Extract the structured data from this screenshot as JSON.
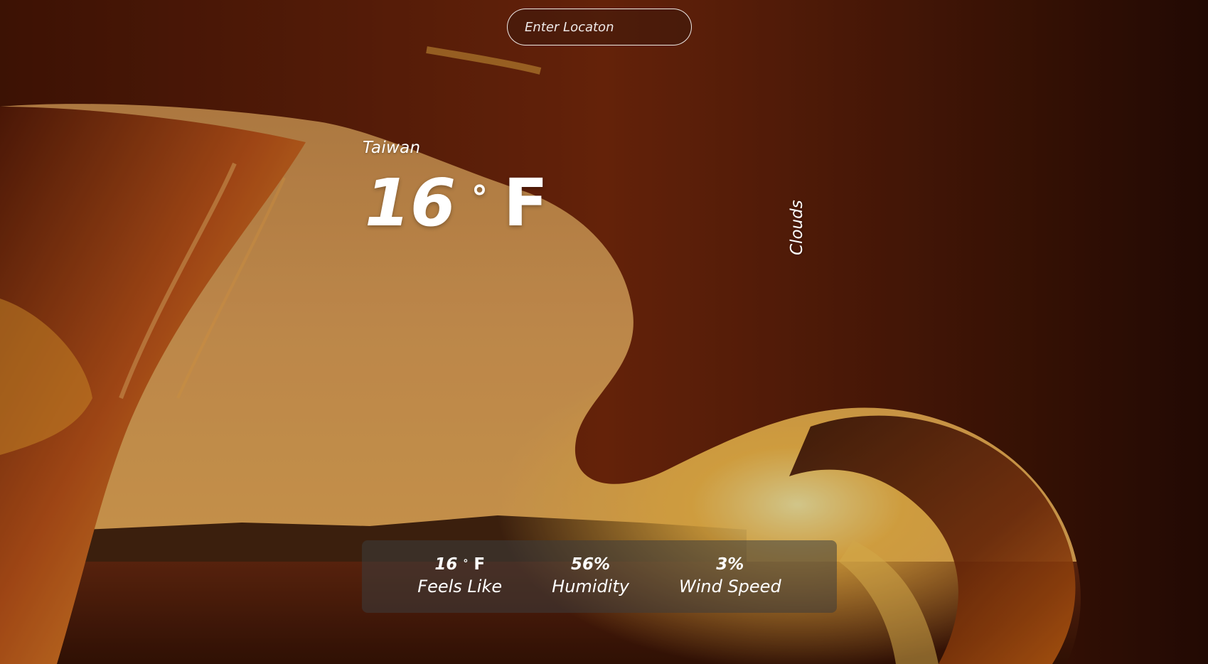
{
  "search": {
    "placeholder": "Enter Locaton",
    "value": ""
  },
  "weather": {
    "location": "Taiwan",
    "temp": "16",
    "temp_degree": "°",
    "temp_unit": "F",
    "condition": "Clouds"
  },
  "stats": [
    {
      "value": "16",
      "degree": "°",
      "unit": "F",
      "label": "Feels Like"
    },
    {
      "value": "56%",
      "label": "Humidity"
    },
    {
      "value": "3%",
      "label": "Wind Speed"
    }
  ],
  "colors": {
    "text": "#ffffff",
    "panel": "#3c3c3c",
    "sky": "#e9a24a",
    "sun": "#ffd36a",
    "wave_dark": "#3a1208"
  }
}
